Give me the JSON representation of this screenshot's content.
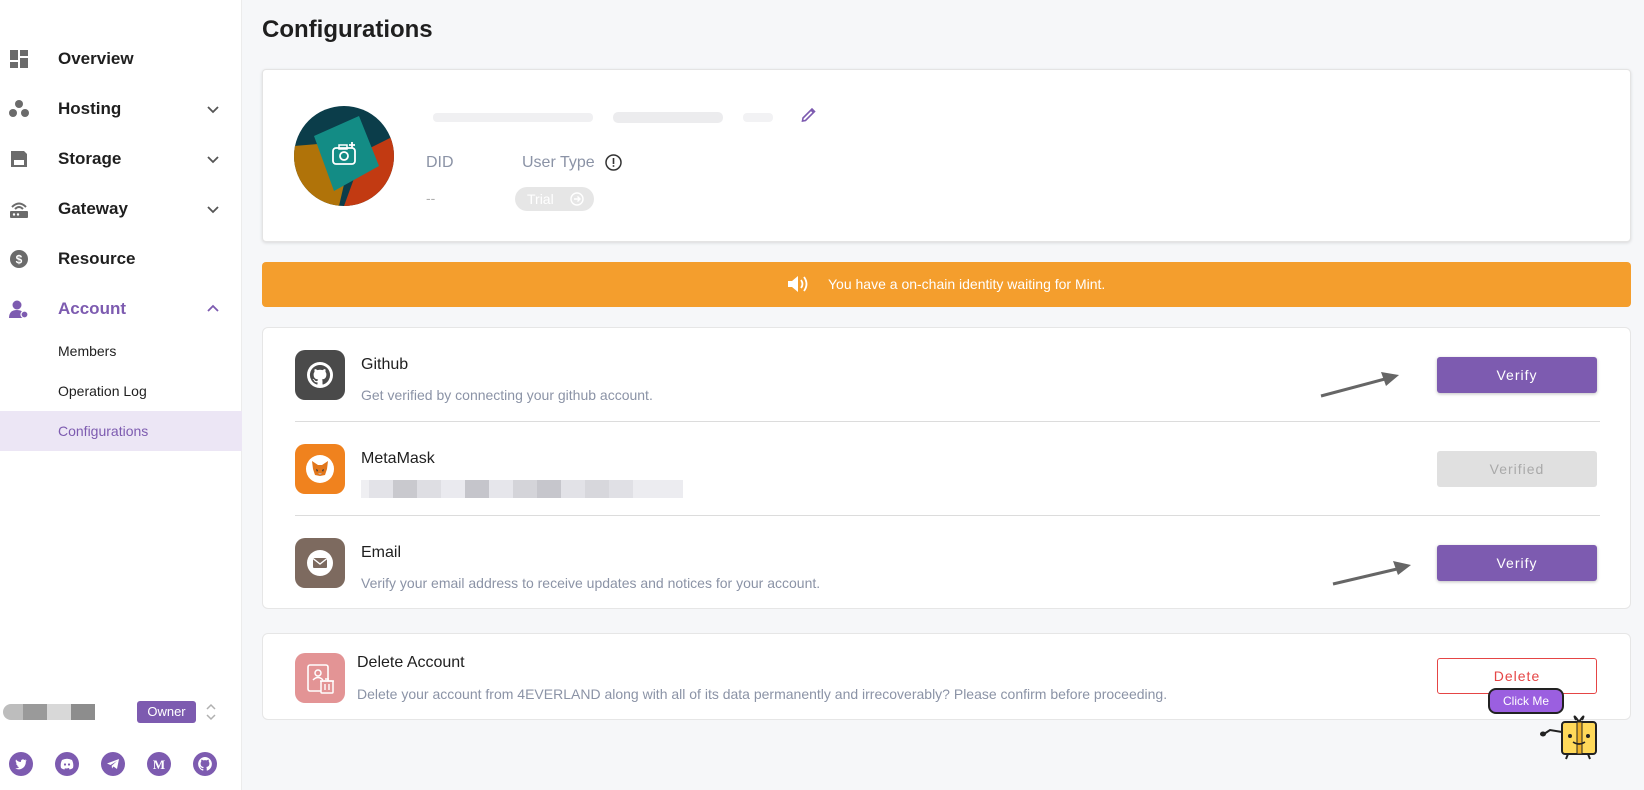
{
  "sidebar": {
    "items": [
      {
        "label": "Overview",
        "icon": "dashboard-icon"
      },
      {
        "label": "Hosting",
        "icon": "hosting-icon"
      },
      {
        "label": "Storage",
        "icon": "storage-icon"
      },
      {
        "label": "Gateway",
        "icon": "gateway-icon"
      },
      {
        "label": "Resource",
        "icon": "resource-icon"
      },
      {
        "label": "Account",
        "icon": "account-icon"
      }
    ],
    "account_sub": [
      "Members",
      "Operation Log",
      "Configurations"
    ],
    "owner_label": "Owner",
    "socials": [
      "twitter-icon",
      "discord-icon",
      "telegram-icon",
      "medium-icon",
      "github-icon"
    ]
  },
  "page": {
    "title": "Configurations"
  },
  "profile": {
    "did_label": "DID",
    "did_value": "--",
    "user_type_label": "User Type",
    "user_type_value": "Trial"
  },
  "banner": {
    "text": "You have a on-chain identity waiting for Mint."
  },
  "verifications": [
    {
      "title": "Github",
      "description": "Get verified by connecting your github account.",
      "button": "Verify",
      "state": "primary"
    },
    {
      "title": "MetaMask",
      "description": "",
      "button": "Verified",
      "state": "disabled"
    },
    {
      "title": "Email",
      "description": "Verify your email address to receive updates and notices for your account.",
      "button": "Verify",
      "state": "primary"
    }
  ],
  "delete_account": {
    "title": "Delete Account",
    "description": "Delete your account from 4EVERLAND along with all of its data permanently and irrecoverably? Please confirm before proceeding.",
    "button": "Delete"
  },
  "mascot": {
    "label": "Click Me"
  },
  "colors": {
    "accent": "#7d5bb0",
    "banner": "#f49e2d",
    "danger": "#e54545"
  }
}
